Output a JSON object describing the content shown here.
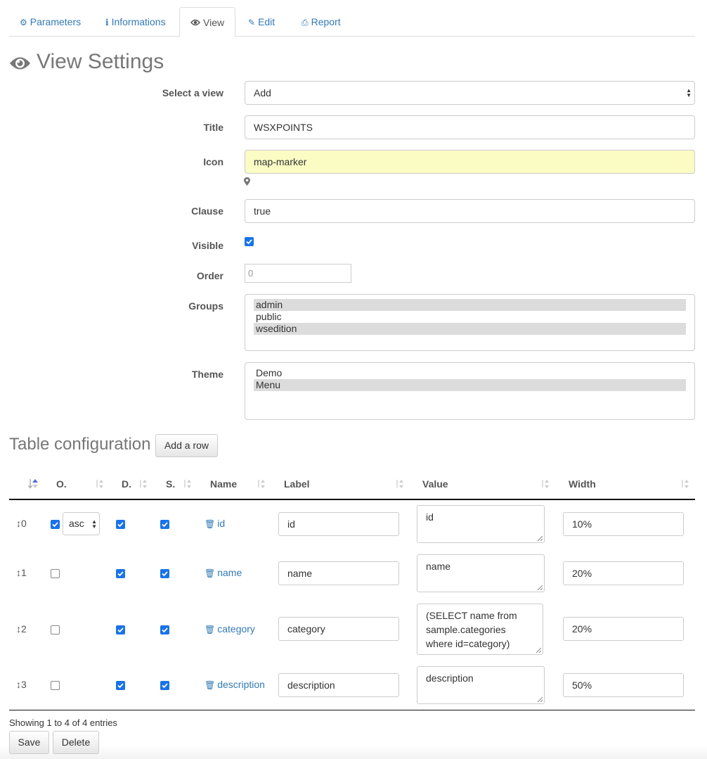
{
  "tabs": [
    {
      "label": "Parameters",
      "icon": "gear-icon"
    },
    {
      "label": "Informations",
      "icon": "info-icon"
    },
    {
      "label": "View",
      "icon": "eye-icon",
      "active": true
    },
    {
      "label": "Edit",
      "icon": "edit-icon"
    },
    {
      "label": "Report",
      "icon": "print-icon"
    }
  ],
  "page": {
    "title": "View Settings",
    "icon": "eye-icon"
  },
  "form": {
    "select_view_label": "Select a view",
    "select_view_value": "Add",
    "title_label": "Title",
    "title_value": "WSXPOINTS",
    "icon_label": "Icon",
    "icon_value": "map-marker",
    "icon_preview": "map-marker-icon",
    "clause_label": "Clause",
    "clause_value": "true",
    "visible_label": "Visible",
    "visible_checked": true,
    "order_label": "Order",
    "order_value": "0",
    "groups_label": "Groups",
    "groups_options": [
      {
        "label": "admin",
        "selected": true
      },
      {
        "label": "public",
        "selected": false
      },
      {
        "label": "wsedition",
        "selected": true
      }
    ],
    "theme_label": "Theme",
    "theme_options": [
      {
        "label": "Demo",
        "selected": false
      },
      {
        "label": "Menu",
        "selected": true
      }
    ]
  },
  "table_config": {
    "title": "Table configuration",
    "add_row_label": "Add a row",
    "headers": {
      "order_col": "",
      "o": "O.",
      "d": "D.",
      "s": "S.",
      "name": "Name",
      "label": "Label",
      "value": "Value",
      "width": "Width"
    },
    "rows": [
      {
        "index": "0",
        "o": true,
        "sort": "asc",
        "d": true,
        "s": true,
        "name": "id",
        "label": "id",
        "value": "id",
        "width": "10%"
      },
      {
        "index": "1",
        "o": false,
        "d": true,
        "s": true,
        "name": "name",
        "label": "name",
        "value": "name",
        "width": "20%"
      },
      {
        "index": "2",
        "o": false,
        "d": true,
        "s": true,
        "name": "category",
        "label": "category",
        "value": "(SELECT name from sample.categories where id=category)",
        "width": "20%"
      },
      {
        "index": "3",
        "o": false,
        "d": true,
        "s": true,
        "name": "description",
        "label": "description",
        "value": "description",
        "width": "50%"
      }
    ],
    "info": "Showing 1 to 4 of 4 entries"
  },
  "actions": {
    "save_label": "Save",
    "delete_label": "Delete"
  },
  "colors": {
    "link": "#337ab7",
    "checkbox": "#1a73e8",
    "icon_field_bg": "#fafcc4"
  }
}
